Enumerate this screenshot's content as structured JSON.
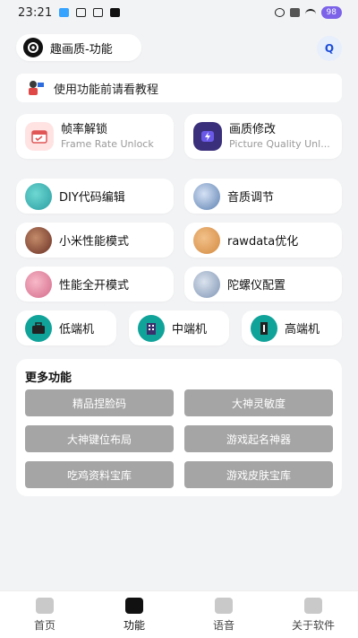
{
  "status": {
    "time": "23:21",
    "battery": "98"
  },
  "header": {
    "title": "趣画质-功能",
    "search_icon_label": "Q"
  },
  "tutorial": {
    "text": "使用功能前请看教程"
  },
  "features_big": [
    {
      "title": "帧率解锁",
      "subtitle": "Frame Rate Unlock"
    },
    {
      "title": "画质修改",
      "subtitle": "Picture Quality Unl..."
    }
  ],
  "features": [
    {
      "label": "DIY代码编辑"
    },
    {
      "label": "音质调节"
    },
    {
      "label": "小米性能模式"
    },
    {
      "label": "rawdata优化"
    },
    {
      "label": "性能全开模式"
    },
    {
      "label": "陀螺仪配置"
    }
  ],
  "device_tiers": [
    {
      "label": "低端机"
    },
    {
      "label": "中端机"
    },
    {
      "label": "高端机"
    }
  ],
  "more": {
    "title": "更多功能",
    "buttons": [
      "精品捏脸码",
      "大神灵敏度",
      "大神键位布局",
      "游戏起名神器",
      "吃鸡资料宝库",
      "游戏皮肤宝库"
    ]
  },
  "nav": [
    {
      "label": "首页"
    },
    {
      "label": "功能"
    },
    {
      "label": "语音"
    },
    {
      "label": "关于软件"
    }
  ]
}
